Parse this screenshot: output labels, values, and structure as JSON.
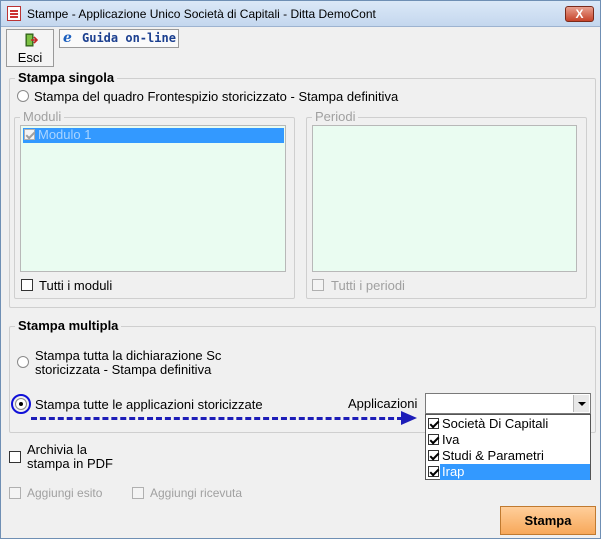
{
  "window": {
    "title": "Stampe - Applicazione Unico Società di Capitali - Ditta  DemoCont",
    "close_label": "X"
  },
  "toolbar": {
    "esci_label": "Esci",
    "guida_label": "Guida on-line"
  },
  "stampa_singola": {
    "title": "Stampa singola",
    "radio_label": "Stampa del quadro Frontespizio storicizzato - Stampa definitiva",
    "radio_checked": false,
    "moduli": {
      "title": "Moduli",
      "items": [
        {
          "label": "Modulo 1",
          "checked": true,
          "selected": true
        }
      ],
      "all_label": "Tutti i moduli",
      "all_checked": false
    },
    "periodi": {
      "title": "Periodi",
      "items": [],
      "all_label": "Tutti i periodi",
      "all_checked": false
    }
  },
  "stampa_multipla": {
    "title": "Stampa multipla",
    "option1_line1": "Stampa tutta la dichiarazione Sc",
    "option1_line2": "storicizzata - Stampa definitiva",
    "option1_checked": false,
    "option2_label": "Stampa tutte le applicazioni storicizzate",
    "option2_checked": true,
    "applicazioni_label": "Applicazioni",
    "applicazioni_value": "",
    "applicazioni_options": [
      {
        "label": "Società Di Capitali",
        "checked": true,
        "selected": false
      },
      {
        "label": "Iva",
        "checked": true,
        "selected": false
      },
      {
        "label": "Studi & Parametri",
        "checked": true,
        "selected": false
      },
      {
        "label": "Irap",
        "checked": true,
        "selected": true
      }
    ]
  },
  "options": {
    "archivia_line1": "Archivia la",
    "archivia_line2": "stampa in PDF",
    "archivia_checked": false,
    "aggiungi_esito": "Aggiungi esito",
    "aggiungi_ricevuta": "Aggiungi ricevuta"
  },
  "actions": {
    "stampa_label": "Stampa"
  },
  "colors": {
    "list_background": "#eafcf1",
    "selection": "#3399ff",
    "stampa_button": "#f7a85a",
    "annotation": "#1d1db8"
  }
}
